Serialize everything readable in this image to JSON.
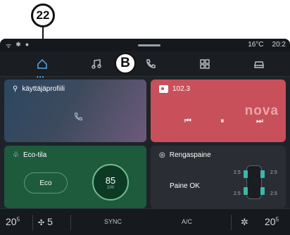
{
  "callout": {
    "number": "22",
    "letter": "B"
  },
  "status": {
    "temperature": "16°C",
    "time": "20:2"
  },
  "cards": {
    "profile": {
      "title": "käyttäjäprofiili"
    },
    "radio": {
      "frequency": "102.3",
      "station_logo_text": "nova",
      "prev": "⏮",
      "pause": "⏸",
      "next": "⏭"
    },
    "eco": {
      "title": "Eco-tila",
      "button": "Eco",
      "gauge_value": "85",
      "gauge_unit": "100"
    },
    "tyres": {
      "title": "Rengaspaine",
      "status": "Paine OK",
      "pressures": {
        "front_left": "2.5",
        "front_right": "2.5",
        "rear_left": "2.5",
        "rear_right": "2.5"
      }
    }
  },
  "bottom": {
    "temp_left": "20",
    "temp_left_half": "5",
    "fan_speed": "5",
    "sync_label": "SYNC",
    "ac_label": "A/C",
    "temp_right": "20",
    "temp_right_half": "5"
  },
  "colors": {
    "accent": "#5aa9e6",
    "radio_card": "#c8505a",
    "eco_card": "#1e5a3c",
    "tyre_indicator": "#3bb7a8"
  }
}
